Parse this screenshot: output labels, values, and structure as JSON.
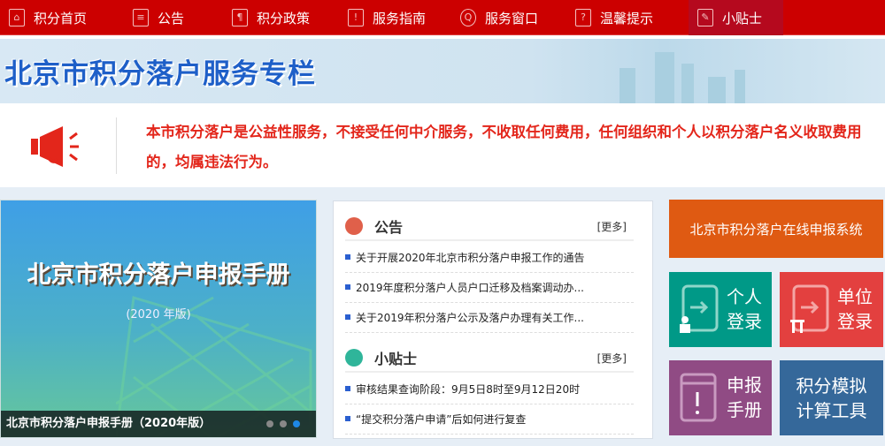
{
  "nav": [
    {
      "label": "积分首页",
      "icon": "home-icon"
    },
    {
      "label": "公告",
      "icon": "document-icon"
    },
    {
      "label": "积分政策",
      "icon": "policy-icon"
    },
    {
      "label": "服务指南",
      "icon": "guide-icon"
    },
    {
      "label": "服务窗口",
      "icon": "search-window-icon"
    },
    {
      "label": "温馨提示",
      "icon": "question-icon"
    },
    {
      "label": "小贴士",
      "icon": "edit-icon",
      "active": true
    }
  ],
  "banner": {
    "title": "北京市积分落户服务专栏"
  },
  "notice": {
    "text": "本市积分落户是公益性服务，不接受任何中介服务，不收取任何费用，任何组织和个人以积分落户名义收取费用的，均属违法行为。"
  },
  "carousel": {
    "title": "北京市积分落户申报手册",
    "edition": "(2020 年版)",
    "caption": "北京市积分落户申报手册（2020年版）",
    "slide_count": 3,
    "active_slide": 3
  },
  "announcements": {
    "title": "公告",
    "more": "[更多]",
    "items": [
      "关于开展2020年北京市积分落户申报工作的通告",
      "2019年度积分落户人员户口迁移及档案调动办...",
      "关于2019年积分落户公示及落户办理有关工作..."
    ]
  },
  "tips": {
    "title": "小贴士",
    "more": "[更多]",
    "items": [
      "审核结果查询阶段：9月5日8时至9月12日20时",
      "“提交积分落户申请”后如何进行复查"
    ]
  },
  "tiles": {
    "online_system": "北京市积分落户在线申报系统",
    "personal": [
      "个人",
      "登录"
    ],
    "unit": [
      "单位",
      "登录"
    ],
    "manual": [
      "申报",
      "手册"
    ],
    "calculator": [
      "积分模拟",
      "计算工具"
    ]
  },
  "colors": {
    "nav": "#cc0000",
    "notice_text": "#e3261b",
    "orange": "#df5a12",
    "teal": "#009987",
    "red": "#e3403f",
    "purple": "#904b84",
    "blue": "#35689a"
  }
}
